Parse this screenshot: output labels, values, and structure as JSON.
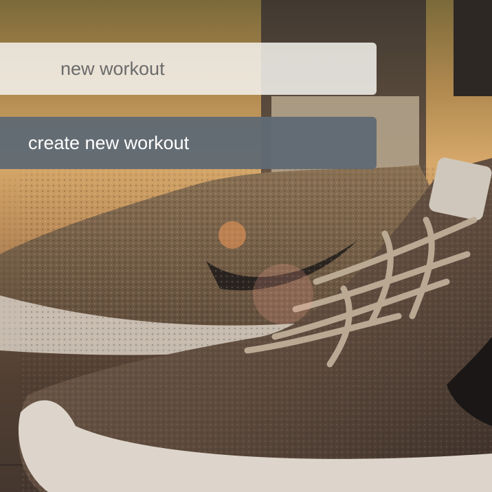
{
  "form": {
    "workout_name_placeholder": "new workout",
    "create_button_label": "create new workout"
  },
  "colors": {
    "input_background": "#f4f2ee",
    "button_background": "#606a74",
    "button_text": "#ffffff",
    "placeholder_text": "#6b6b6b"
  }
}
